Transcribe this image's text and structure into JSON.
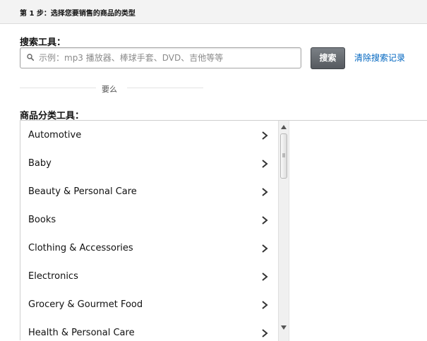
{
  "header": {
    "step_title": "第 1 步：选择您要销售的商品的类型"
  },
  "search": {
    "label": "搜索工具：",
    "placeholder": "示例：mp3 播放器、棒球手套、DVD、吉他等等",
    "button_label": "搜索",
    "clear_link": "清除搜索记录"
  },
  "divider": {
    "text": "要么"
  },
  "category_tool": {
    "label": "商品分类工具：",
    "items": [
      {
        "label": "Automotive"
      },
      {
        "label": "Baby"
      },
      {
        "label": "Beauty & Personal Care"
      },
      {
        "label": "Books"
      },
      {
        "label": "Clothing & Accessories"
      },
      {
        "label": "Electronics"
      },
      {
        "label": "Grocery & Gourmet Food"
      },
      {
        "label": "Health & Personal Care"
      }
    ]
  },
  "colors": {
    "link": "#0066c0",
    "button": "#5f6368",
    "header_bg": "#f3f3f3"
  },
  "icons": {
    "search": "magnifier-icon",
    "chevron": "chevron-right-icon"
  }
}
